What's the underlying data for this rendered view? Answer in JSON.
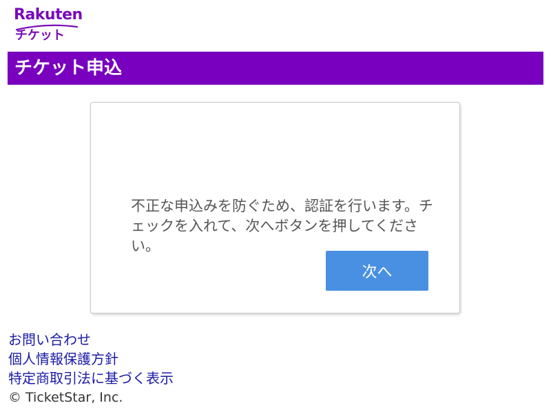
{
  "logo": {
    "brand": "Rakuten",
    "product": "チケット",
    "color": "#7a0ab8"
  },
  "header": {
    "title": "チケット申込",
    "background": "#7800be"
  },
  "card": {
    "message": "不正な申込みを防ぐため、認証を行います。チェックを入れて、次へボタンを押してください。",
    "next_button_label": "次へ",
    "button_color": "#4a90e2"
  },
  "footer": {
    "links": [
      {
        "label": "お問い合わせ"
      },
      {
        "label": "個人情報保護方針"
      },
      {
        "label": "特定商取引法に基づく表示"
      }
    ],
    "copyright": "© TicketStar, Inc.",
    "link_color": "#1a1aa6"
  }
}
